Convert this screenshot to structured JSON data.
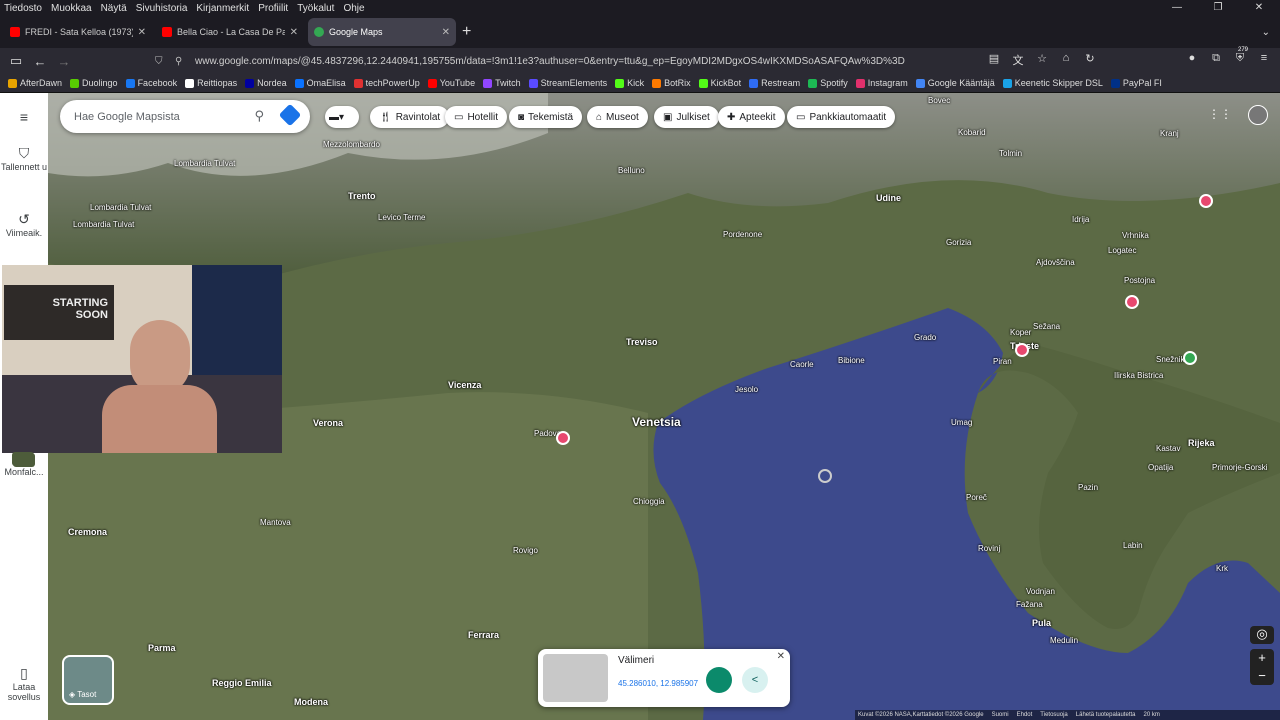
{
  "menubar": [
    "Tiedosto",
    "Muokkaa",
    "Näytä",
    "Sivuhistoria",
    "Kirjanmerkit",
    "Profiilit",
    "Työkalut",
    "Ohje"
  ],
  "tabs": [
    {
      "title": "FREDI - Sata Kelloa (1973) - You",
      "color": "#ff0000"
    },
    {
      "title": "Bella Ciao - La Casa De Papel (N",
      "color": "#ff0000"
    },
    {
      "title": "Google Maps",
      "color": "#34a853"
    }
  ],
  "url": "www.google.com/maps/@45.4837296,12.2440941,195755m/data=!3m1!1e3?authuser=0&entry=ttu&g_ep=EgoyMDI2MDgxOS4wIKXMDSoASAFQAw%3D%3D",
  "badge_count": "279",
  "bookmarks": [
    {
      "label": "AfterDawn",
      "color": "#e8a400"
    },
    {
      "label": "Duolingo",
      "color": "#58cc02"
    },
    {
      "label": "Facebook",
      "color": "#1877f2"
    },
    {
      "label": "Reittiopas",
      "color": "#ffffff"
    },
    {
      "label": "Nordea",
      "color": "#0000a0"
    },
    {
      "label": "OmaElisa",
      "color": "#0a72ff"
    },
    {
      "label": "techPowerUp",
      "color": "#e03131"
    },
    {
      "label": "YouTube",
      "color": "#ff0000"
    },
    {
      "label": "Twitch",
      "color": "#9146ff"
    },
    {
      "label": "StreamElements",
      "color": "#5a4bff"
    },
    {
      "label": "Kick",
      "color": "#53fc18"
    },
    {
      "label": "BotRix",
      "color": "#ff7a00"
    },
    {
      "label": "KickBot",
      "color": "#53fc18"
    },
    {
      "label": "Restream",
      "color": "#2f6cf5"
    },
    {
      "label": "Spotify",
      "color": "#1db954"
    },
    {
      "label": "Instagram",
      "color": "#e1306c"
    },
    {
      "label": "Google Kääntäjä",
      "color": "#4285f4"
    },
    {
      "label": "Keenetic Skipper DSL",
      "color": "#1aa3e8"
    },
    {
      "label": "PayPal FI",
      "color": "#003087"
    }
  ],
  "sidebar": {
    "saved": "Tallennett u",
    "recent": "Viimeaik.",
    "monfalcone": "Monfalc...",
    "app": "Lataa sovellus"
  },
  "search_placeholder": "Hae Google Mapsista",
  "chips": [
    "Ravintolat",
    "Hotellit",
    "Tekemistä",
    "Museot",
    "Julkiset",
    "Apteekit",
    "Pankkiautomaatit"
  ],
  "places": [
    {
      "t": "Lombardia Tulvat"
    },
    {
      "t": "Lombardia Tulvat"
    },
    {
      "t": "Lombardia Tulvat"
    },
    {
      "t": "Mezzolombardo"
    },
    {
      "t": "Trento"
    },
    {
      "t": "Levico Terme"
    },
    {
      "t": "Belluno"
    },
    {
      "t": "Udine"
    },
    {
      "t": "Pordenone"
    },
    {
      "t": "Treviso"
    },
    {
      "t": "Vicenza"
    },
    {
      "t": "Verona"
    },
    {
      "t": "Padova"
    },
    {
      "t": "Venetsia"
    },
    {
      "t": "Chioggia"
    },
    {
      "t": "Rovigo"
    },
    {
      "t": "Ferrara"
    },
    {
      "t": "Mantova"
    },
    {
      "t": "Cremona"
    },
    {
      "t": "Parma"
    },
    {
      "t": "Reggio Emilia"
    },
    {
      "t": "Modena"
    },
    {
      "t": "Trieste"
    },
    {
      "t": "Koper"
    },
    {
      "t": "Piran"
    },
    {
      "t": "Umag"
    },
    {
      "t": "Poreč"
    },
    {
      "t": "Rovinj"
    },
    {
      "t": "Pula"
    },
    {
      "t": "Rijeka"
    },
    {
      "t": "Opatija"
    },
    {
      "t": "Gorizia"
    },
    {
      "t": "Grado"
    },
    {
      "t": "Caorle"
    },
    {
      "t": "Jesolo"
    },
    {
      "t": "Bibione"
    },
    {
      "t": "Primorje-Gorski"
    },
    {
      "t": "Ilirska Bistrica"
    },
    {
      "t": "Snežnik"
    },
    {
      "t": "Postojna"
    },
    {
      "t": "Tolmin"
    },
    {
      "t": "Bovec"
    },
    {
      "t": "Kobarid"
    },
    {
      "t": "Kranj"
    },
    {
      "t": "Vrhnika"
    },
    {
      "t": "Logatec"
    },
    {
      "t": "Idrija"
    },
    {
      "t": "Ajdovščina"
    },
    {
      "t": "Sežana"
    },
    {
      "t": "Kastav"
    },
    {
      "t": "Labin"
    },
    {
      "t": "Pazin"
    },
    {
      "t": "Medulin"
    },
    {
      "t": "Fažana"
    },
    {
      "t": "Vodnjan"
    },
    {
      "t": "Krk"
    }
  ],
  "card": {
    "title": "Välimeri",
    "coords": "45.286010, 12.985907"
  },
  "footer": [
    "Kuvat ©2026 NASA,Karttatiedot ©2026 Google",
    "Suomi",
    "Ehdot",
    "Tietosuoja",
    "Lähetä tuotepalautetta",
    "20 km"
  ],
  "webcam_text": [
    "STARTING",
    "SOON"
  ]
}
